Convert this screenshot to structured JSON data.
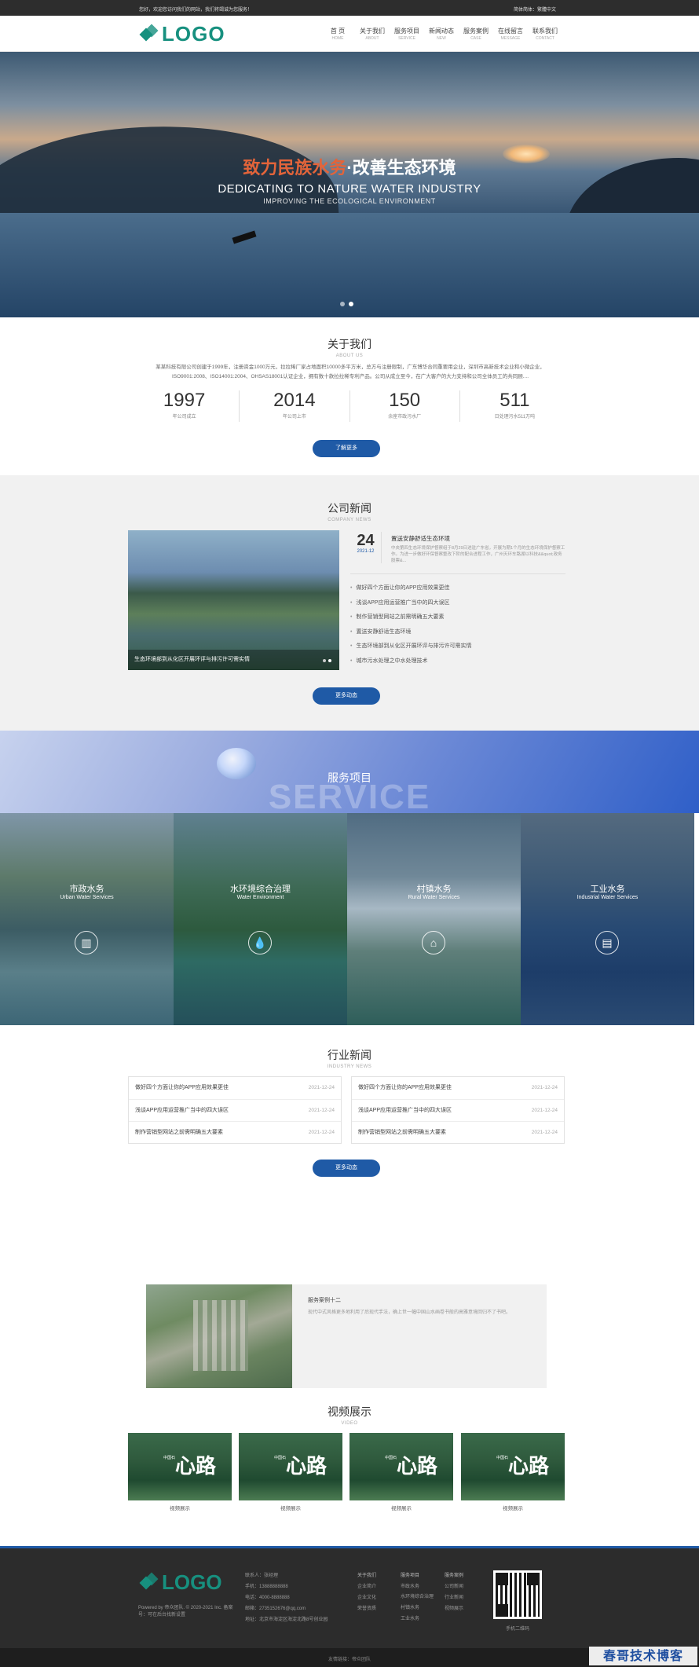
{
  "topbar": {
    "left": "您好，欢迎您访问我们的网站，我们将竭诚为您服务！",
    "right": "简体简体：繁體中文"
  },
  "header": {
    "logo": "LOGO",
    "nav": [
      {
        "cn": "首 页",
        "en": "HOME"
      },
      {
        "cn": "关于我们",
        "en": "ABOUT"
      },
      {
        "cn": "服务项目",
        "en": "SERVICE"
      },
      {
        "cn": "新闻动态",
        "en": "NEW"
      },
      {
        "cn": "服务案例",
        "en": "CASE"
      },
      {
        "cn": "在线留言",
        "en": "MESSAGE"
      },
      {
        "cn": "联系我们",
        "en": "CONTACT"
      }
    ]
  },
  "hero": {
    "title_orange": "致力民族水务",
    "title_white": "·改善生态环境",
    "subtitle": "DEDICATING TO NATURE WATER INDUSTRY",
    "subtitle2": "IMPROVING THE ECOLOGICAL ENVIRONMENT"
  },
  "about": {
    "title": "关于我们",
    "title_en": "ABOUT US",
    "text": "某某科技有限公司创建于1999年，注册资金1000万元，拉拉稀厂家占地面积10000多平方米，总方与注册限制，广东博华合同重要用企业，深圳市高新技术企业和小微企业，ISO9001:2008、ISO14001:2004、OHSAS18001认证企业，拥有数十款拉拉稀专利产品。公司从成立至今，在广大客户的大力支持和公司全体员工的共同顾....",
    "stats": [
      {
        "num": "1997",
        "label": "年公司成立"
      },
      {
        "num": "2014",
        "label": "年公司上市"
      },
      {
        "num": "150",
        "label": "余座市政污水厂"
      },
      {
        "num": "511",
        "label": "日处理污水511万吨"
      }
    ],
    "button": "了解更多"
  },
  "company_news": {
    "title": "公司新闻",
    "title_en": "COMPANY NEWS",
    "image_caption": "生态环境部到从化区开展环评与排污许可需实情",
    "top_day": "24",
    "top_ym": "2021-12",
    "top_title": "置送安静舒适生态环境",
    "top_desc": "中央第四生态环境保护督察组于8月29日进驻广东省，开展为期1个月的生态环境保护督察工作。为进一步做好环保督察整改下阶的配合进程工作，广州天环车路湖以科技&&quot;政务股票&...",
    "list": [
      "做好四个方面让你的APP应用效果更佳",
      "浅谈APP应用运营推广当中的四大误区",
      "制作营销型网站之前需明确五大要素",
      "置送安静舒适生态环境",
      "生态环境部到从化区开展环评与排污许可需实情",
      "城市污水处理之中水处理技术"
    ],
    "button": "更多动态"
  },
  "service": {
    "title": "服务项目",
    "watermark": "SERVICE",
    "items": [
      {
        "cn": "市政水务",
        "en": "Urban Water Services",
        "icon": "building-icon"
      },
      {
        "cn": "水环境综合治理",
        "en": "Water Environment",
        "icon": "water-drop-icon"
      },
      {
        "cn": "村镇水务",
        "en": "Rural Water Services",
        "icon": "house-drop-icon"
      },
      {
        "cn": "工业水务",
        "en": "Industrial Water Services",
        "icon": "factory-icon"
      }
    ]
  },
  "industry_news": {
    "title": "行业新闻",
    "title_en": "INDUSTRY NEWS",
    "left": [
      {
        "t": "做好四个方面让你的APP应用效果更佳",
        "d": "2021-12-24"
      },
      {
        "t": "浅谈APP应用运营推广当中的四大误区",
        "d": "2021-12-24"
      },
      {
        "t": "制作营销型网站之前需明确五大要素",
        "d": "2021-12-24"
      }
    ],
    "right": [
      {
        "t": "做好四个方面让你的APP应用效果更佳",
        "d": "2021-12-24"
      },
      {
        "t": "浅谈APP应用运营推广当中的四大误区",
        "d": "2021-12-24"
      },
      {
        "t": "制作营销型网站之前需明确五大要素",
        "d": "2021-12-24"
      }
    ],
    "button": "更多动态"
  },
  "case": {
    "title": "服务案例十二",
    "desc": "现代中式风格更多地利用了后现代手法，确上世一幅中国山水画卷书般的高雅意境回归不了书吧。"
  },
  "video": {
    "title": "视频展示",
    "title_en": "VIDEO",
    "thumb_text": "心路",
    "thumb_small": "中国石",
    "items": [
      "视频展示",
      "视频展示",
      "视频展示",
      "视频展示"
    ]
  },
  "footer": {
    "logo": "LOGO",
    "copyright": "Powered by 帝众团队. © 2020-2021 Inc. 备案号：可在后台找新设置",
    "contact": [
      "联系人：张经理",
      "手机：13888888888",
      "电话：4000-8888888",
      "邮箱：2735152676@qq.com",
      "地址：北京市海淀区海淀北路8号创业园"
    ],
    "col1": [
      "关于我们",
      "企业简介",
      "企业文化",
      "荣誉资质"
    ],
    "col2": [
      "服务项目",
      "市政水务",
      "水环境综合治理",
      "村镇水务",
      "工业水务"
    ],
    "col3": [
      "服务案例",
      "公司新闻",
      "行业新闻",
      "视频展示"
    ],
    "qr_caption": "手机二维码",
    "bottom": "友情链接：帝众团队"
  },
  "watermark": "春哥技术博客"
}
